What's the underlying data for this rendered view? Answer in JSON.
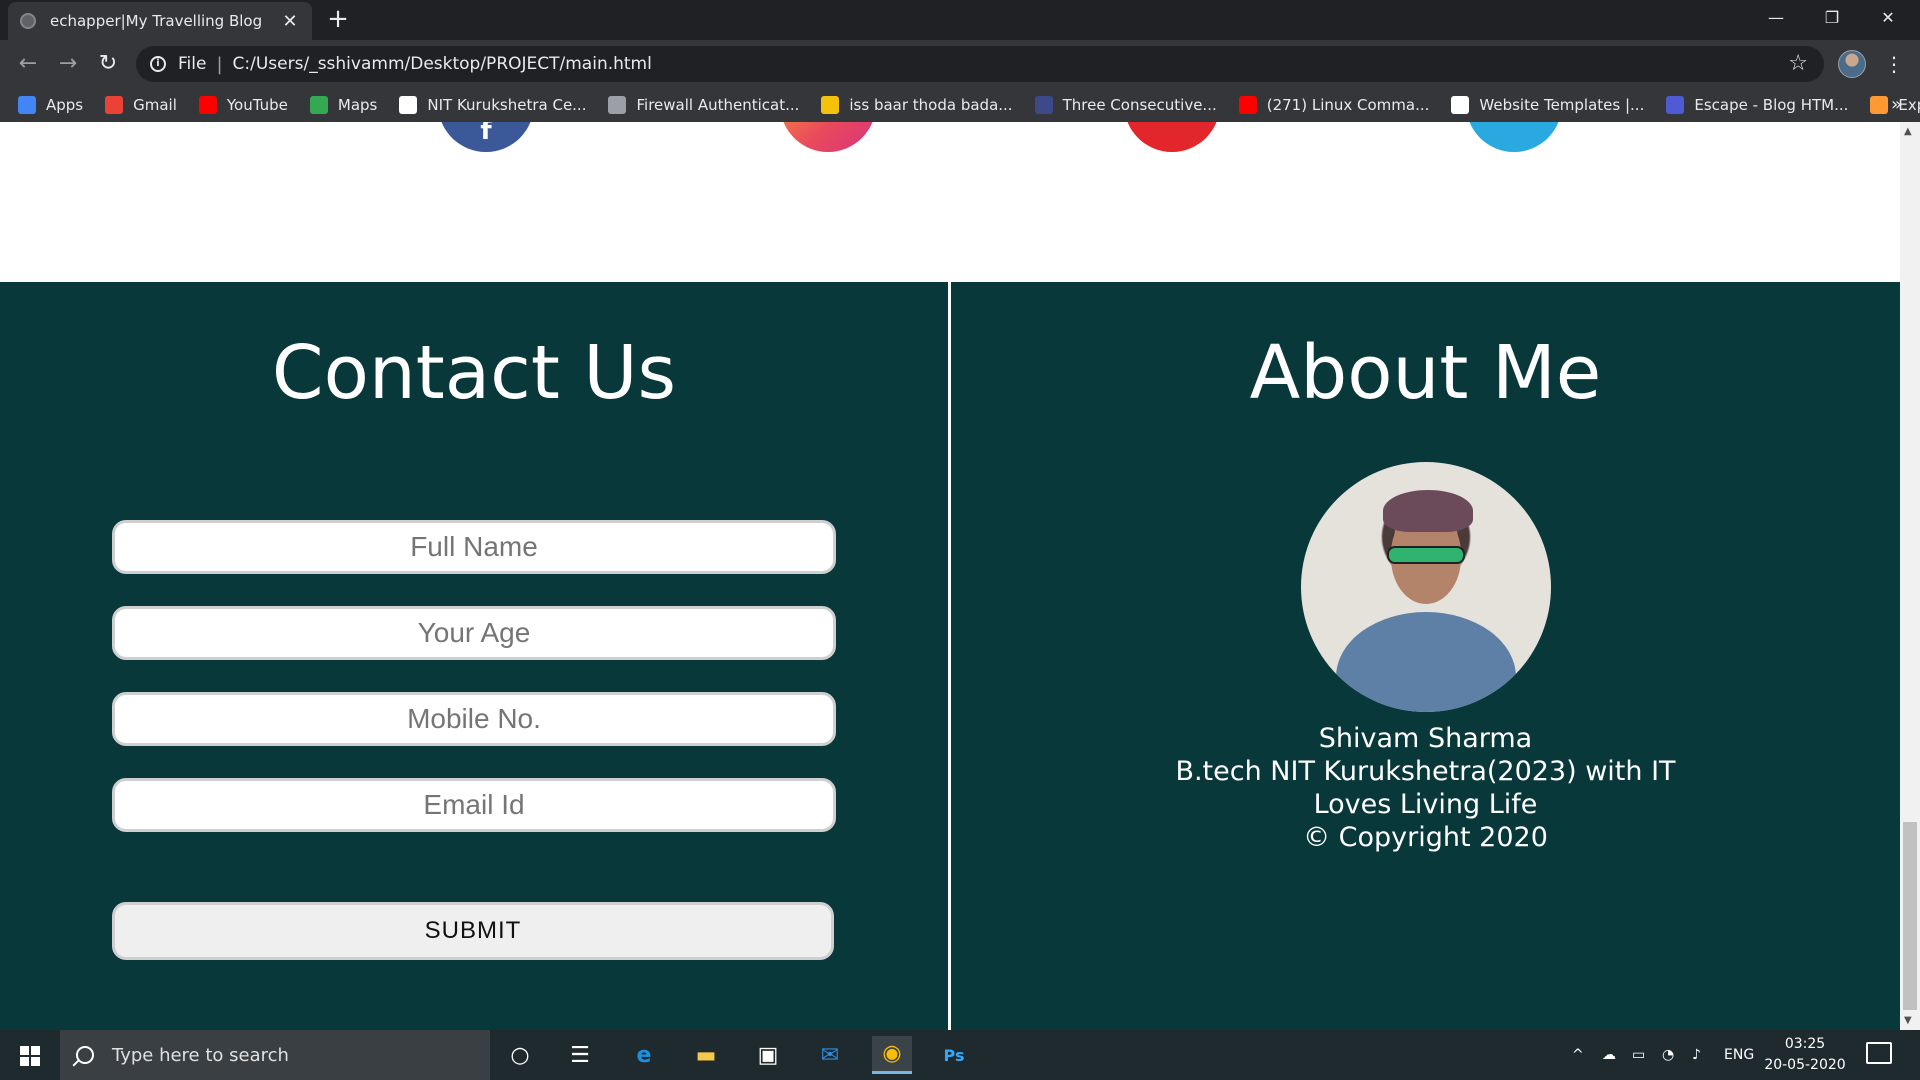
{
  "browser": {
    "tab_title": "echapper|My Travelling Blog",
    "tab_close": "✕",
    "new_tab": "+",
    "window_controls": {
      "minimize": "—",
      "restore": "❐",
      "close": "✕"
    },
    "nav": {
      "back": "←",
      "forward": "→",
      "reload": "↻"
    },
    "address": {
      "scheme": "File",
      "separator": "|",
      "url": "C:/Users/_sshivamm/Desktop/PROJECT/main.html",
      "star": "☆"
    },
    "menu": "⋮",
    "bookmarks": [
      {
        "label": "Apps",
        "icon": "apps-grid-icon",
        "color": "#4285f4"
      },
      {
        "label": "Gmail",
        "icon": "gmail-icon",
        "color": "#ea4335"
      },
      {
        "label": "YouTube",
        "icon": "youtube-icon",
        "color": "#ff0000"
      },
      {
        "label": "Maps",
        "icon": "maps-icon",
        "color": "#34a853"
      },
      {
        "label": "NIT Kurukshetra Ce...",
        "icon": "nit-k-icon",
        "color": "#ffffff"
      },
      {
        "label": "Firewall Authenticat...",
        "icon": "globe-icon",
        "color": "#9aa0a6"
      },
      {
        "label": "iss baar thoda bada...",
        "icon": "smiley-icon",
        "color": "#f4c20d"
      },
      {
        "label": "Three Consecutive...",
        "icon": "doc-icon",
        "color": "#3c4a8a"
      },
      {
        "label": "(271) Linux Comma...",
        "icon": "youtube-icon",
        "color": "#ff0000"
      },
      {
        "label": "Website Templates |...",
        "icon": "wix-icon",
        "color": "#ffffff"
      },
      {
        "label": "Escape - Blog HTM...",
        "icon": "w-icon",
        "color": "#4f5bd5"
      },
      {
        "label": "Explore India",
        "icon": "india-flag-icon",
        "color": "#ff9933"
      }
    ],
    "bookmarks_more": "»"
  },
  "page": {
    "contact": {
      "title": "Contact Us",
      "fields": [
        {
          "placeholder": "Full Name"
        },
        {
          "placeholder": "Your Age"
        },
        {
          "placeholder": "Mobile No."
        },
        {
          "placeholder": "Email Id"
        }
      ],
      "submit": "SUBMIT"
    },
    "about": {
      "title": "About Me",
      "lines": [
        "Shivam Sharma",
        "B.tech NIT Kurukshetra(2023) with IT",
        "Loves Living Life",
        "© Copyright 2020"
      ]
    },
    "social_icons": [
      "facebook-icon",
      "instagram-icon",
      "pinterest-icon",
      "twitter-icon"
    ],
    "colors": {
      "footer_bg": "#08383a",
      "divider": "#ffffff",
      "text": "#ffffff"
    }
  },
  "taskbar": {
    "search_placeholder": "Type here to search",
    "tray_lang": "ENG",
    "time": "03:25",
    "date": "20-05-2020"
  }
}
